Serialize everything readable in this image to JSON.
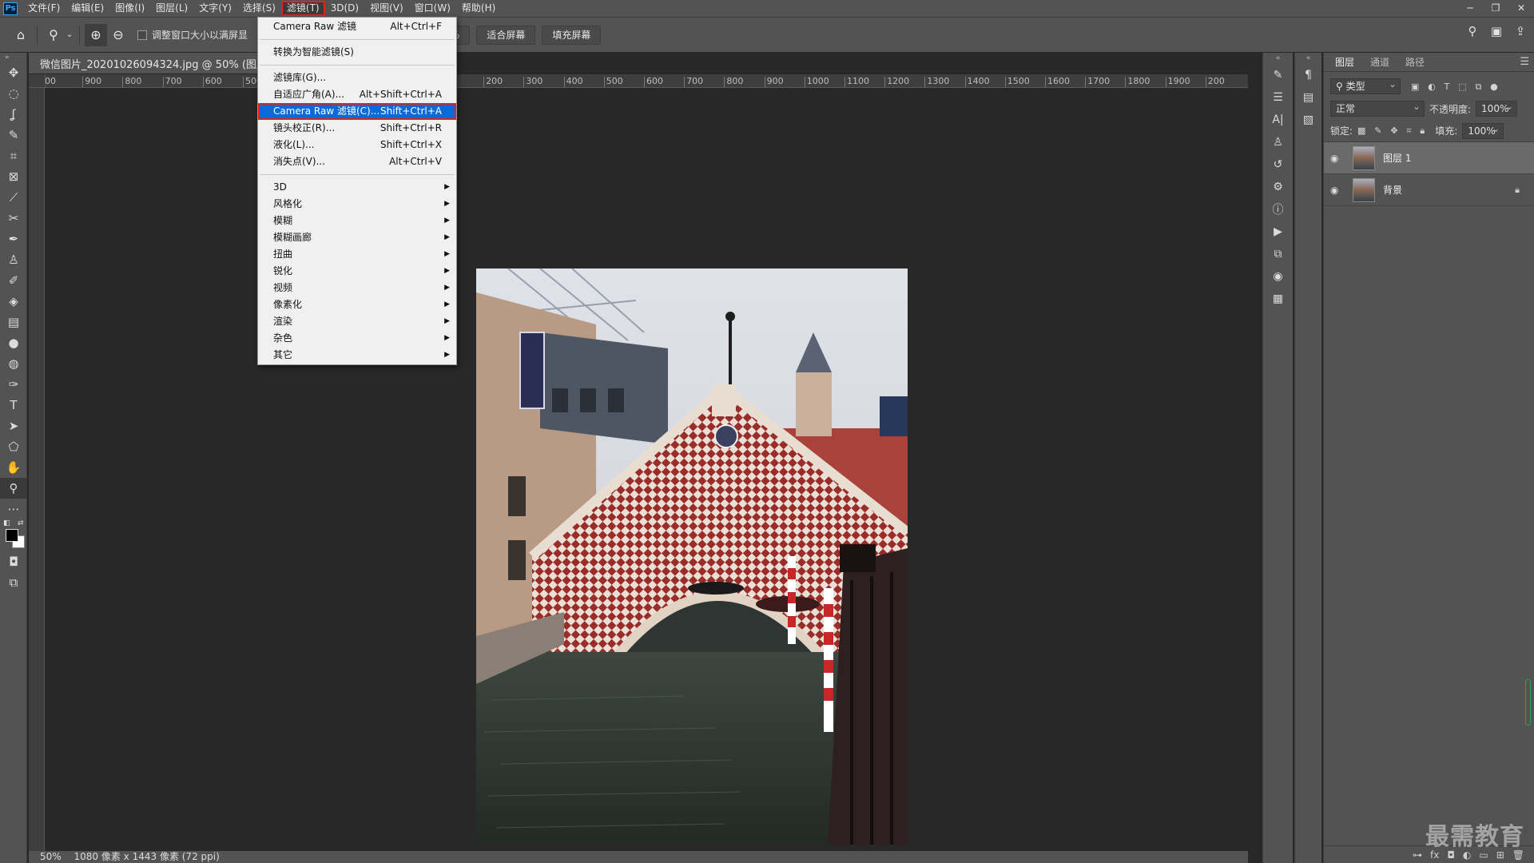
{
  "app": {
    "logo": "Ps"
  },
  "menubar": {
    "items": [
      "文件(F)",
      "编辑(E)",
      "图像(I)",
      "图层(L)",
      "文字(Y)",
      "选择(S)",
      "滤镜(T)",
      "3D(D)",
      "视图(V)",
      "窗口(W)",
      "帮助(H)"
    ],
    "active": "滤镜(T)"
  },
  "window_controls": {
    "minimize": "─",
    "restore": "❐",
    "close": "✕"
  },
  "options_bar": {
    "resize_label": "调整窗口大小以满屏显",
    "zoom_value": "100%",
    "fit_screen": "适合屏幕",
    "fill_screen": "填充屏幕"
  },
  "document": {
    "tab_title": "微信图片_20201026094324.jpg @ 50% (图层 1, RGB/8#) *",
    "status_zoom": "50%",
    "status_info": "1080 像素 x 1443 像素 (72 ppi)"
  },
  "ruler_top": [
    "00",
    "900",
    "800",
    "700",
    "600",
    "500",
    "",
    "",
    "",
    "",
    "",
    "200",
    "300",
    "400",
    "500",
    "600",
    "700",
    "800",
    "900",
    "1000",
    "1100",
    "1200",
    "1300",
    "1400",
    "1500",
    "1600",
    "1700",
    "1800",
    "1900",
    "200"
  ],
  "filter_menu": {
    "groups": [
      [
        {
          "label": "Camera Raw 滤镜",
          "shortcut": "Alt+Ctrl+F"
        }
      ],
      [
        {
          "label": "转换为智能滤镜(S)",
          "shortcut": ""
        }
      ],
      [
        {
          "label": "滤镜库(G)...",
          "shortcut": ""
        },
        {
          "label": "自适应广角(A)...",
          "shortcut": "Alt+Shift+Ctrl+A"
        },
        {
          "label": "Camera Raw 滤镜(C)...",
          "shortcut": "Shift+Ctrl+A",
          "highlighted": true
        },
        {
          "label": "镜头校正(R)...",
          "shortcut": "Shift+Ctrl+R"
        },
        {
          "label": "液化(L)...",
          "shortcut": "Shift+Ctrl+X"
        },
        {
          "label": "消失点(V)...",
          "shortcut": "Alt+Ctrl+V"
        }
      ],
      [
        {
          "label": "3D",
          "submenu": true
        },
        {
          "label": "风格化",
          "submenu": true
        },
        {
          "label": "模糊",
          "submenu": true
        },
        {
          "label": "模糊画廊",
          "submenu": true
        },
        {
          "label": "扭曲",
          "submenu": true
        },
        {
          "label": "锐化",
          "submenu": true
        },
        {
          "label": "视频",
          "submenu": true
        },
        {
          "label": "像素化",
          "submenu": true
        },
        {
          "label": "渲染",
          "submenu": true
        },
        {
          "label": "杂色",
          "submenu": true
        },
        {
          "label": "其它",
          "submenu": true
        }
      ]
    ]
  },
  "layers_panel": {
    "tabs": [
      "图层",
      "通道",
      "路径"
    ],
    "active_tab": "图层",
    "filter_kind": "类型",
    "blend_mode": "正常",
    "opacity_label": "不透明度:",
    "opacity_value": "100%",
    "lock_label": "锁定:",
    "fill_label": "填充:",
    "fill_value": "100%",
    "layers": [
      {
        "name": "图层 1",
        "selected": true,
        "locked": false
      },
      {
        "name": "背景",
        "selected": false,
        "locked": true
      }
    ]
  },
  "watermark": "最需教育",
  "colors": {
    "chrome": "#535353",
    "canvas": "#282828",
    "menu_highlight": "#0a6bd8",
    "annotation_red": "#e2231a"
  }
}
